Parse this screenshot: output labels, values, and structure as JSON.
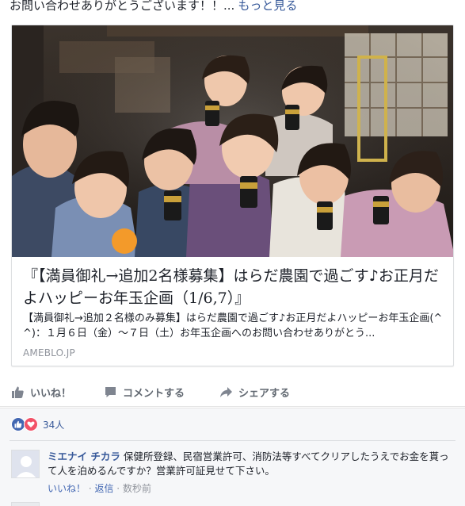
{
  "post": {
    "text": "お問い合わせありがとうございます！！...",
    "more_label": "もっと見る"
  },
  "link_card": {
    "title": "『【満員御礼→追加2名様募集】はらだ農園で過ごす♪お正月だよハッピーお年玉企画（1/6,7）』",
    "description": "【満員御礼→追加２名様のみ募集】はらだ農園で過ごす♪お正月だよハッピーお年玉企画(^ ^)：１月６日（金）〜７日（土）お年玉企画へのお問い合わせありがとう...",
    "domain": "AMEBLO.JP"
  },
  "actions": {
    "like": "いいね！",
    "comment": "コメントする",
    "share": "シェアする"
  },
  "reactions": {
    "count": "34人",
    "like_color": "#4267b2",
    "love_color": "#f25268"
  },
  "comment": {
    "author": "ミエナイ チカラ",
    "text": "保健所登録、民宿営業許可、消防法等すべてクリアしたうえでお金を貰って人を泊めるんですか？営業許可証見せて下さい。",
    "like": "いいね！",
    "sep1": " · ",
    "reply": "返信",
    "sep2": " · ",
    "time": "数秒前"
  },
  "colors": {
    "link": "#365899",
    "muted": "#90949c",
    "action": "#606770",
    "panel": "#f6f7f9"
  }
}
